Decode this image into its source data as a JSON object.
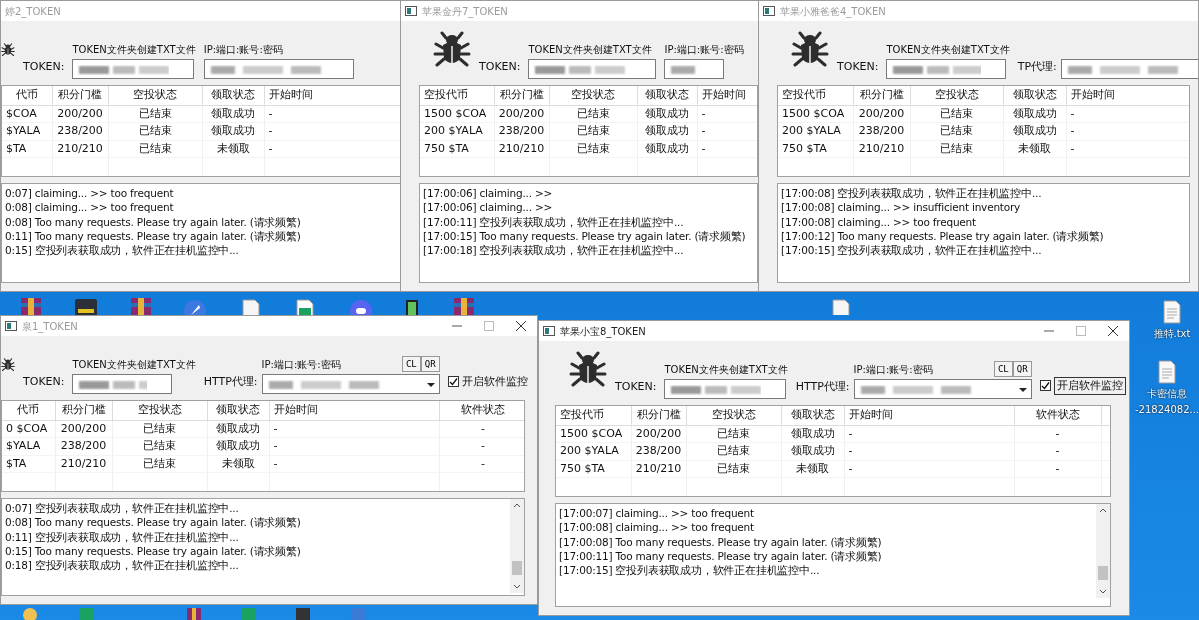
{
  "desktop": {
    "icons": [
      {
        "kind": "file",
        "lines": [
          "推特.txt"
        ]
      },
      {
        "kind": "file",
        "lines": [
          "卡密信息",
          "-21824082..."
        ]
      }
    ]
  },
  "windows": [
    {
      "title": "婷2_TOKEN",
      "active": false,
      "window_controls": false,
      "token_caption": "TOKEN文件夹创建TXT文件",
      "proxy_caption": "IP:端口:账号:密码",
      "token_label": "TOKEN:",
      "columns": [
        "代币",
        "积分门槛",
        "空投状态",
        "领取状态",
        "开始时间"
      ],
      "rows": [
        [
          "$COA",
          "200/200",
          "已结束",
          "领取成功",
          "-"
        ],
        [
          "$YALA",
          "238/200",
          "已结束",
          "领取成功",
          "-"
        ],
        [
          "$TA",
          "210/210",
          "已结束",
          "未领取",
          "-"
        ]
      ],
      "log": [
        "0:07] claiming... >> too frequent",
        "0:08] claiming... >> too frequent",
        "0:08] Too many requests. Please try again later. (请求频繁)",
        "0:11] Too many requests. Please try again later. (请求频繁)",
        "0:15] 空投列表获取成功，软件正在挂机监控中..."
      ]
    },
    {
      "title": "苹果金丹7_TOKEN",
      "active": false,
      "window_controls": false,
      "token_caption": "TOKEN文件夹创建TXT文件",
      "proxy_caption": "IP:端口:账号:密码",
      "token_label": "TOKEN:",
      "columns": [
        "空投代币",
        "积分门槛",
        "空投状态",
        "领取状态",
        "开始时间"
      ],
      "rows": [
        [
          "1500 $COA",
          "200/200",
          "已结束",
          "领取成功",
          "-"
        ],
        [
          "200 $YALA",
          "238/200",
          "已结束",
          "领取成功",
          "-"
        ],
        [
          "750 $TA",
          "210/210",
          "已结束",
          "领取成功",
          "-"
        ]
      ],
      "log": [
        "[17:00:06] claiming... >>",
        "[17:00:06] claiming... >>",
        "[17:00:11] 空投列表获取成功，软件正在挂机监控中...",
        "[17:00:15] Too many requests. Please try again later. (请求频繁)",
        "[17:00:18] 空投列表获取成功，软件正在挂机监控中..."
      ]
    },
    {
      "title": "苹果小雅爸爸4_TOKEN",
      "active": false,
      "window_controls": false,
      "token_caption": "TOKEN文件夹创建TXT文件",
      "token_label": "TOKEN:",
      "proxy_label": "TP代理:",
      "columns": [
        "空投代币",
        "积分门槛",
        "空投状态",
        "领取状态",
        "开始时间"
      ],
      "rows": [
        [
          "1500 $COA",
          "200/200",
          "已结束",
          "领取成功",
          "-"
        ],
        [
          "200 $YALA",
          "238/200",
          "已结束",
          "领取成功",
          "-"
        ],
        [
          "750 $TA",
          "210/210",
          "已结束",
          "未领取",
          "-"
        ]
      ],
      "log": [
        "[17:00:08] 空投列表获取成功，软件正在挂机监控中...",
        "[17:00:08] claiming... >> insufficient inventory",
        "[17:00:08] claiming... >> too frequent",
        "[17:00:12] Too many requests. Please try again later. (请求频繁)",
        "[17:00:15] 空投列表获取成功，软件正在挂机监控中..."
      ]
    },
    {
      "title": "泉1_TOKEN",
      "active": false,
      "window_controls": true,
      "token_caption": "TOKEN文件夹创建TXT文件",
      "proxy_caption": "IP:端口:账号:密码",
      "token_label": "TOKEN:",
      "proxy_label": "HTTP代理:",
      "proxy_dropdown": true,
      "tool_buttons": [
        "CL",
        "QR"
      ],
      "monitor": {
        "label": "开启软件监控",
        "checked": true,
        "focused": false
      },
      "columns": [
        "代币",
        "积分门槛",
        "空投状态",
        "领取状态",
        "开始时间",
        "软件状态"
      ],
      "rows": [
        [
          "0 $COA",
          "200/200",
          "已结束",
          "领取成功",
          "-",
          "-"
        ],
        [
          "$YALA",
          "238/200",
          "已结束",
          "领取成功",
          "-",
          "-"
        ],
        [
          "$TA",
          "210/210",
          "已结束",
          "未领取",
          "-",
          "-"
        ]
      ],
      "log": [
        "0:07] 空投列表获取成功，软件正在挂机监控中...",
        "0:08] Too many requests. Please try again later. (请求频繁)",
        "0:11] 空投列表获取成功，软件正在挂机监控中...",
        "0:15] Too many requests. Please try again later. (请求频繁)",
        "0:18] 空投列表获取成功，软件正在挂机监控中..."
      ]
    },
    {
      "title": "苹果小宝8_TOKEN",
      "active": true,
      "window_controls": true,
      "token_caption": "TOKEN文件夹创建TXT文件",
      "proxy_caption": "IP:端口:账号:密码",
      "token_label": "TOKEN:",
      "proxy_label": "HTTP代理:",
      "proxy_dropdown": true,
      "tool_buttons": [
        "CL",
        "QR"
      ],
      "monitor": {
        "label": "开启软件监控",
        "checked": true,
        "focused": true
      },
      "columns": [
        "空投代币",
        "积分门槛",
        "空投状态",
        "领取状态",
        "开始时间",
        "软件状态"
      ],
      "rows": [
        [
          "1500 $COA",
          "200/200",
          "已结束",
          "领取成功",
          "-",
          "-"
        ],
        [
          "200 $YALA",
          "238/200",
          "已结束",
          "领取成功",
          "-",
          "-"
        ],
        [
          "750 $TA",
          "210/210",
          "已结束",
          "未领取",
          "-",
          "-"
        ]
      ],
      "log": [
        "[17:00:07] claiming... >> too frequent",
        "[17:00:08] claiming... >> too frequent",
        "[17:00:08] Too many requests. Please try again later. (请求频繁)",
        "[17:00:11] Too many requests. Please try again later. (请求频繁)",
        "[17:00:15] 空投列表获取成功，软件正在挂机监控中..."
      ]
    }
  ]
}
